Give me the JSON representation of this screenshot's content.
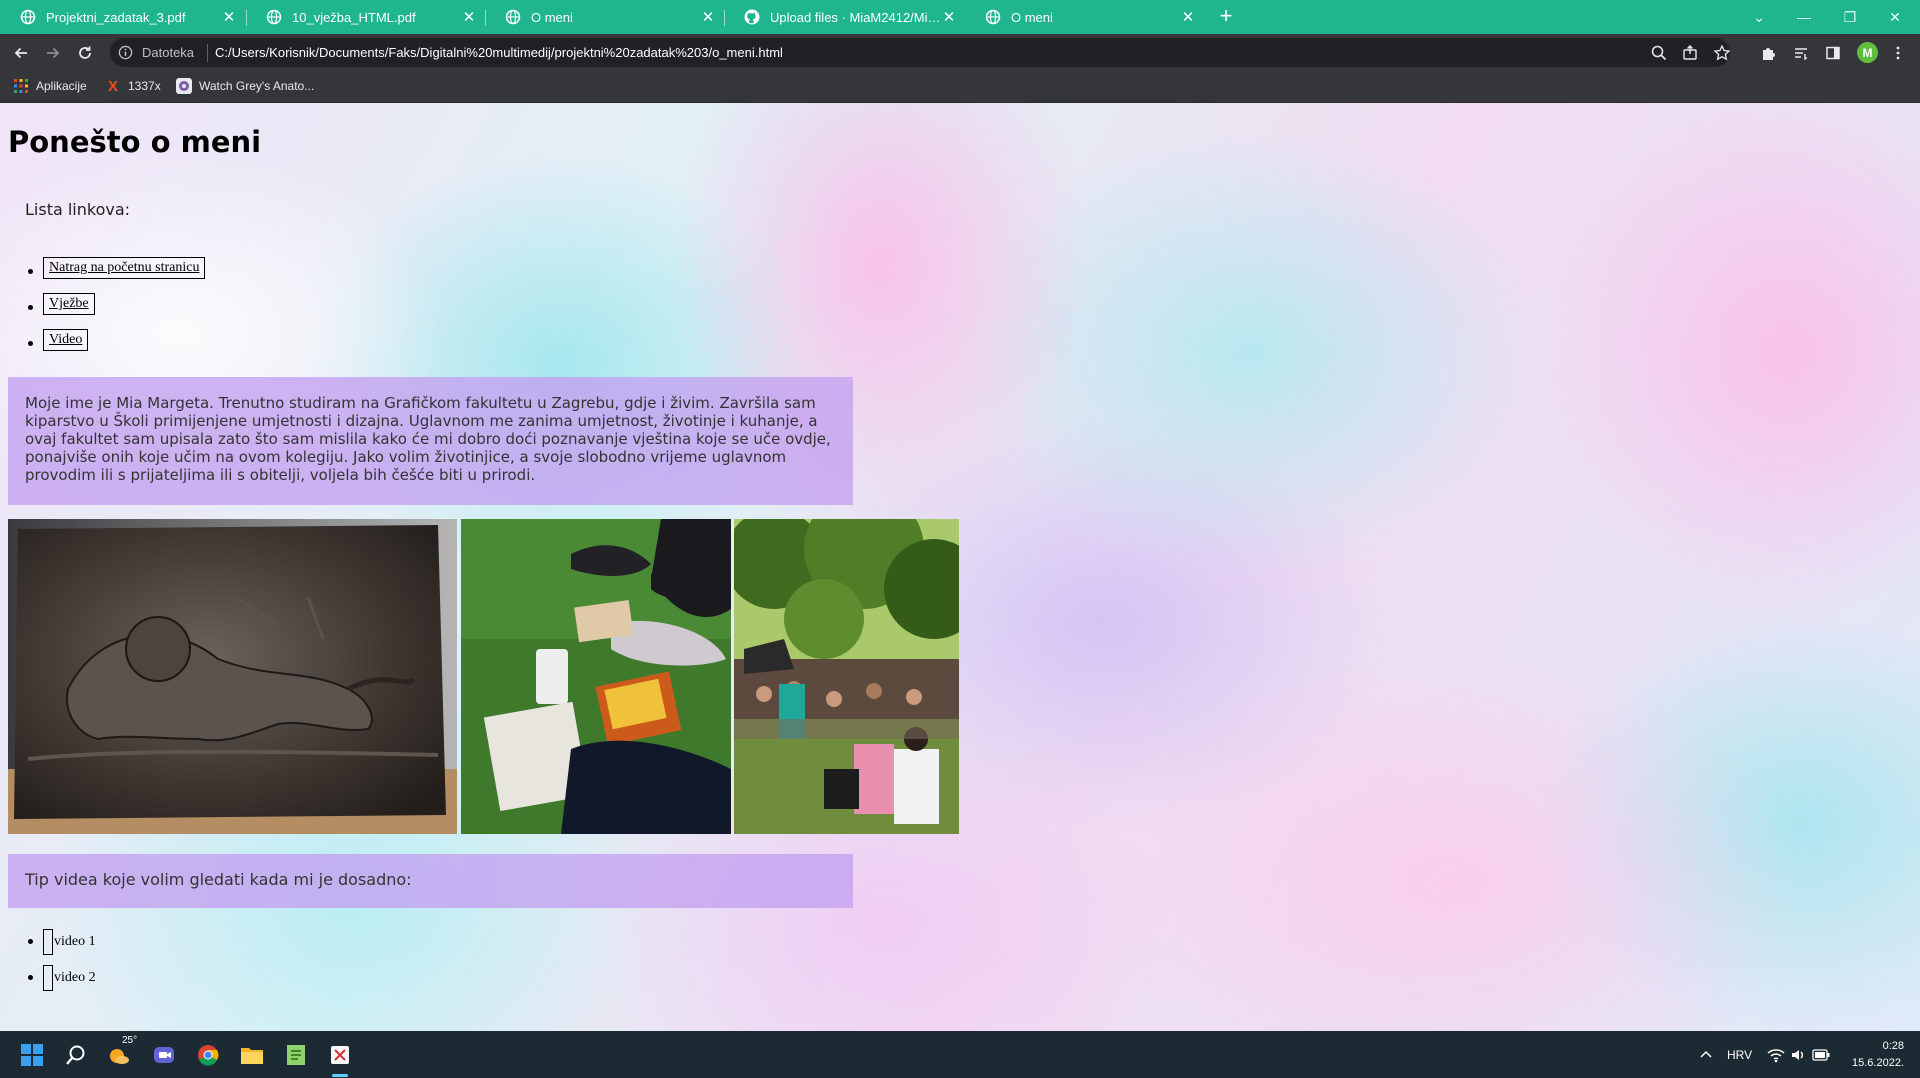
{
  "browser": {
    "tabs": [
      {
        "title": "Projektni_zadatak_3.pdf",
        "active": false
      },
      {
        "title": "10_vježba_HTML.pdf",
        "active": false
      },
      {
        "title": "O meni",
        "active": false
      },
      {
        "title": "Upload files · MiaM2412/Mia-Margeta",
        "active": false
      },
      {
        "title": "O meni",
        "active": true
      }
    ],
    "new_tab": "+",
    "address": {
      "chip_label": "Datoteka",
      "url": "C:/Users/Korisnik/Documents/Faks/Digitalni%20multimedij/projektni%20zadatak%203/o_meni.html"
    },
    "profile_initial": "M",
    "bookmarks": [
      {
        "label": "Aplikacije",
        "icon": "apps-grid-icon"
      },
      {
        "label": "1337x",
        "icon": "x-logo-icon"
      },
      {
        "label": "Watch Grey's Anato...",
        "icon": "greys-anatomy-icon"
      }
    ],
    "colors": {
      "tab_strip": "#1fb58f",
      "toolbar": "#35363a",
      "omnibox": "#202124"
    }
  },
  "page": {
    "title": "Ponešto o meni",
    "links_label": "Lista linkova:",
    "links": [
      "Natrag na početnu stranicu",
      "Vježbe",
      "Video"
    ],
    "bio": "Moje ime je Mia Margeta. Trenutno studiram na Grafičkom fakultetu u Zagrebu, gdje i živim. Završila sam kiparstvo u Školi primijenjene umjetnosti i dizajna. Uglavnom me zanima umjetnost, životinje i kuhanje, a ovaj fakultet sam upisala zato što sam mislila kako će mi dobro doći poznavanje vještina koje se uče ovdje, ponajviše onih koje učim na ovom kolegiju. Jako volim životinjice, a svoje slobodno vrijeme uglavnom provodim ili s prijateljima ili s obitelji, voljela bih češće biti u prirodi.",
    "photos": [
      "bronze-lion-relief-photo",
      "picnic-on-grass-photo",
      "crowd-in-park-photo"
    ],
    "video_intro": "Tip videa koje volim gledati kada mi je dosadno:",
    "videos": [
      "video 1",
      "video 2"
    ],
    "colors": {
      "box": "#c3a0f0"
    }
  },
  "taskbar": {
    "weather": "25°",
    "language": "HRV",
    "time": "0:28",
    "date": "15.6.2022."
  }
}
